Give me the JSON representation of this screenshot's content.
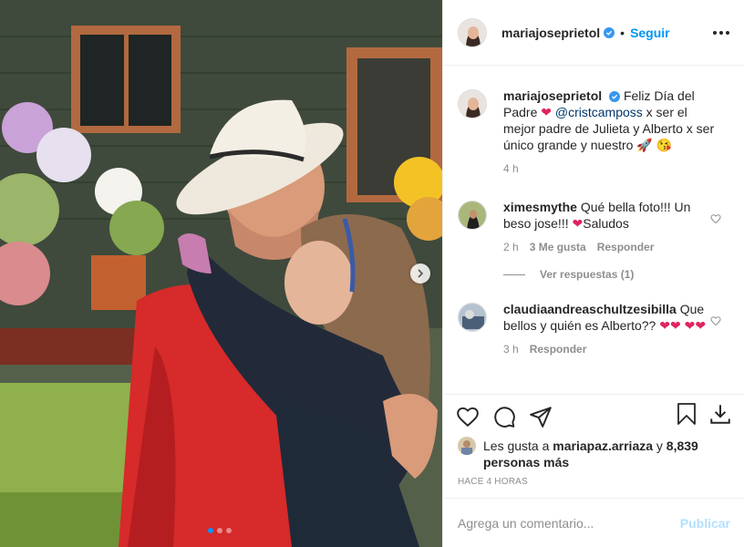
{
  "post": {
    "username": "mariajoseprietol",
    "follow_label": "Seguir",
    "caption_username": "mariajoseprietol",
    "caption_text_1": "Feliz Día del Padre",
    "caption_mention": "@cristcamposs",
    "caption_text_2": "x ser el mejor padre de Julieta y Alberto x ser único grande y nuestro",
    "caption_time": "4 h"
  },
  "comments": [
    {
      "username": "ximesmythe",
      "text": "Qué bella foto!!! Un beso jose!!!",
      "text_after": "Saludos",
      "time": "2 h",
      "likes": "3 Me gusta",
      "reply_label": "Responder",
      "view_replies": "Ver respuestas (1)"
    },
    {
      "username": "claudiaandreaschultzesibilla",
      "text": "Que bellos y quién es Alberto??",
      "time": "3 h",
      "reply_label": "Responder"
    }
  ],
  "likes": {
    "prefix": "Les gusta a",
    "user": "mariapaz.arriaza",
    "connector": "y",
    "count": "8,839 personas más"
  },
  "timestamp": "HACE 4 HORAS",
  "add_comment": {
    "placeholder": "Agrega un comentario...",
    "publish_label": "Publicar"
  },
  "colors": {
    "accent": "#0095f6",
    "heart": "#ed4956",
    "muted": "#8e8e8e"
  },
  "carousel": {
    "current": 1,
    "total": 3
  }
}
